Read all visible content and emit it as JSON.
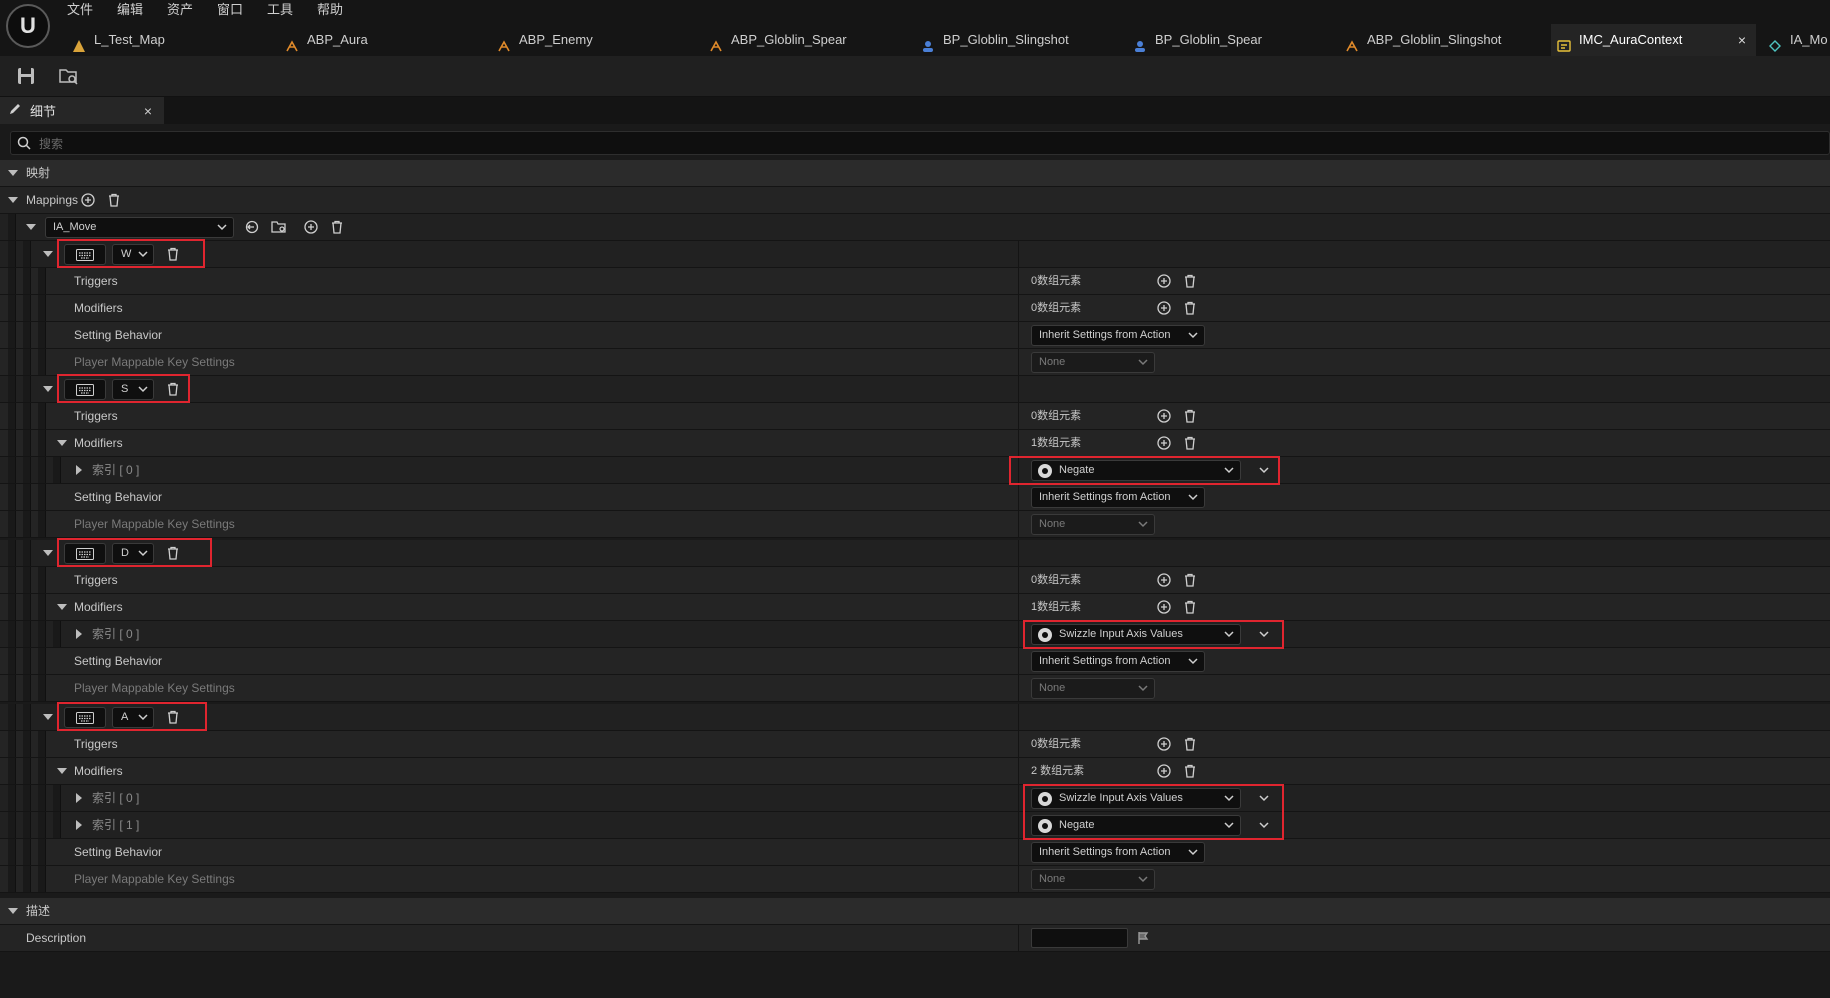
{
  "menu": [
    "文件",
    "编辑",
    "资产",
    "窗口",
    "工具",
    "帮助"
  ],
  "tabs": [
    {
      "label": "L_Test_Map",
      "icon": "level-icon"
    },
    {
      "label": "ABP_Aura",
      "icon": "anim-blueprint-icon"
    },
    {
      "label": "ABP_Enemy",
      "icon": "anim-blueprint-icon"
    },
    {
      "label": "ABP_Globlin_Spear",
      "icon": "anim-blueprint-icon"
    },
    {
      "label": "BP_Globlin_Slingshot",
      "icon": "blueprint-icon"
    },
    {
      "label": "BP_Globlin_Spear",
      "icon": "blueprint-icon"
    },
    {
      "label": "ABP_Globlin_Slingshot",
      "icon": "anim-blueprint-icon"
    },
    {
      "label": "IMC_AuraContext",
      "icon": "input-mapping-icon"
    },
    {
      "label": "IA_Mo",
      "icon": "input-action-icon"
    }
  ],
  "tab_close": "×",
  "panel": {
    "title": "细节",
    "close": "×",
    "search_placeholder": "搜索"
  },
  "sections": {
    "mappings_cat": "映射",
    "desc_cat": "描述"
  },
  "mappings_label": "Mappings",
  "action": "IA_Move",
  "keys": [
    "W",
    "S",
    "D",
    "A"
  ],
  "labels": {
    "triggers": "Triggers",
    "modifiers": "Modifiers",
    "setting_behavior": "Setting Behavior",
    "player_mappable": "Player Mappable Key Settings",
    "description": "Description"
  },
  "counts": {
    "zero": "0数组元素",
    "one": "1数组元素",
    "two": "2 数组元素"
  },
  "index_labels": [
    "索引 [ 0 ]",
    "索引 [ 1 ]"
  ],
  "values": {
    "inherit": "Inherit Settings from Action",
    "none": "None",
    "negate": "Negate",
    "swizzle": "Swizzle Input Axis Values"
  },
  "colors": {
    "highlight": "#e0252f",
    "background": "#1a1a1a",
    "row": "#242424"
  }
}
